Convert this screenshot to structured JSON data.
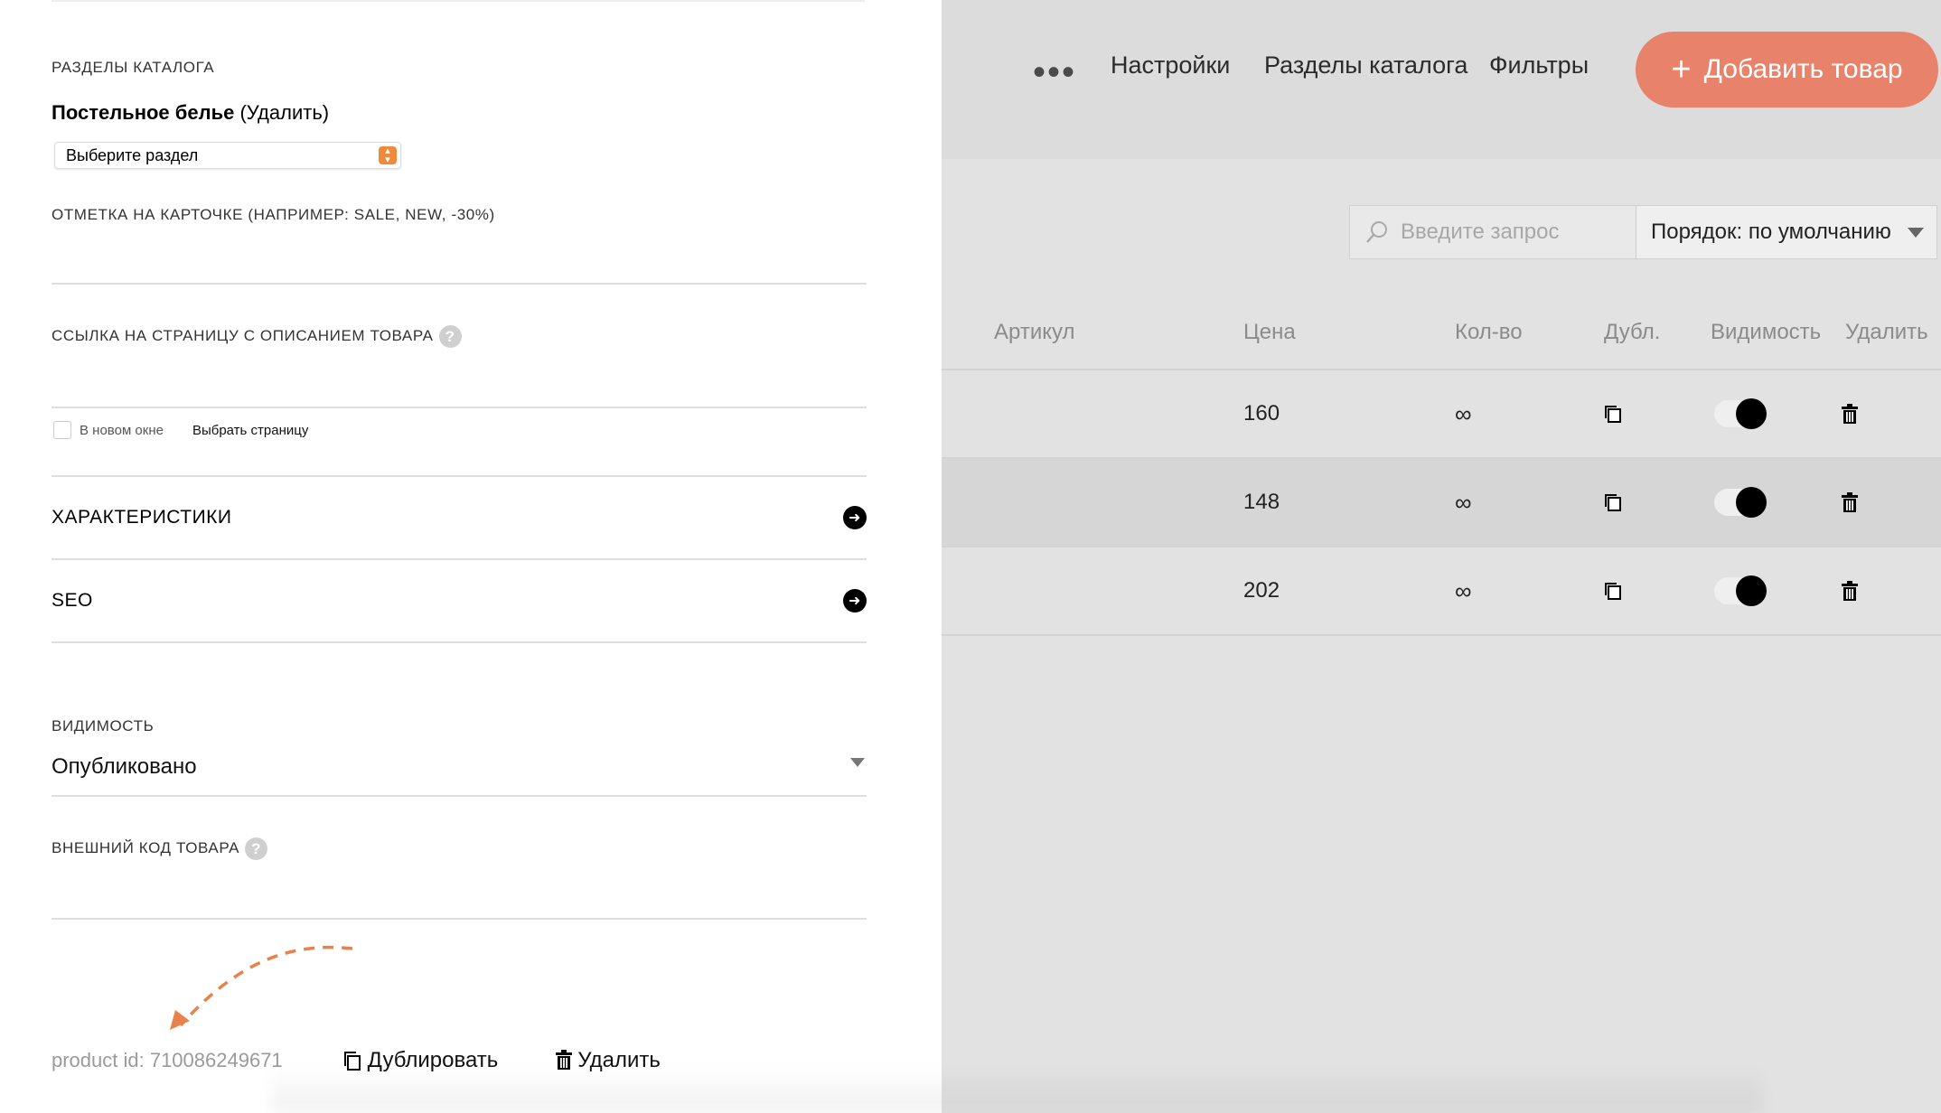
{
  "nav": {
    "more": "•••",
    "settings": "Настройки",
    "sections": "Разделы каталога",
    "filters": "Фильтры",
    "add_product": "Добавить товар"
  },
  "toolbar": {
    "search_placeholder": "Введите запрос",
    "sort_label": "Порядок: по умолчанию"
  },
  "table": {
    "headers": [
      "Артикул",
      "Цена",
      "Кол-во",
      "Дубл.",
      "Видимость",
      "Удалить"
    ],
    "rows": [
      {
        "price": "160",
        "qty": "∞",
        "visible": true
      },
      {
        "price": "148",
        "qty": "∞",
        "visible": true
      },
      {
        "price": "202",
        "qty": "∞",
        "visible": true
      }
    ]
  },
  "panel": {
    "catalog_sections_label": "РАЗДЕЛЫ КАТАЛОГА",
    "section_name": "Постельное белье",
    "section_remove": "(Удалить)",
    "section_select": "Выберите раздел",
    "badge_label": "ОТМЕТКА НА КАРТОЧКЕ (НАПРИМЕР: SALE, NEW, -30%)",
    "link_label": "ССЫЛКА НА СТРАНИЦУ С ОПИСАНИЕМ ТОВАРА",
    "new_window": "В новом окне",
    "choose_page": "Выбрать страницу",
    "characteristics": "ХАРАКТЕРИСТИКИ",
    "seo": "SEO",
    "visibility_label": "ВИДИМОСТЬ",
    "visibility_value": "Опубликовано",
    "external_code_label": "ВНЕШНИЙ КОД ТОВАРА",
    "product_id": "product id: 710086249671",
    "duplicate": "Дублировать",
    "delete": "Удалить",
    "help": "?"
  },
  "colors": {
    "accent": "#e8826a",
    "arrow": "#e8814e",
    "select_stepper": "#ef8a3c"
  },
  "icons": {
    "search": "search-icon",
    "duplicate": "duplicate-icon",
    "trash": "trash-icon",
    "arrow_right": "arrow-right-circle-icon",
    "help": "help-icon"
  }
}
